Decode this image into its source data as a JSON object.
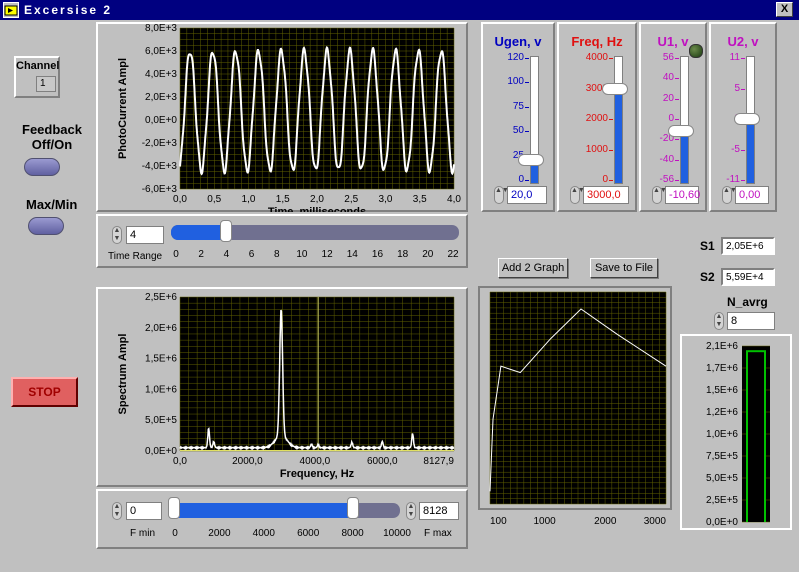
{
  "window": {
    "title": "Excersise 2",
    "close_label": "X"
  },
  "controls": {
    "channel": {
      "label": "Channel",
      "value": "1"
    },
    "feedback_label": "Feedback\nOff/On",
    "maxmin_label": "Max/Min",
    "stop_label": "STOP",
    "time_range": {
      "label": "Time Range",
      "value": "4",
      "level": 4,
      "ticks": [
        "0",
        "2",
        "4",
        "6",
        "8",
        "10",
        "12",
        "14",
        "16",
        "18",
        "20",
        "22"
      ]
    },
    "freq_range": {
      "fmin_label": "F min",
      "fmin_value": "0",
      "fmax_label": "F max",
      "fmax_value": "8128",
      "ticks": [
        "0",
        "2000",
        "4000",
        "6000",
        "8000",
        "10000"
      ]
    },
    "add_graph_label": "Add 2 Graph",
    "save_file_label": "Save to File",
    "s1": {
      "label": "S1",
      "value": "2,05E+6"
    },
    "s2": {
      "label": "S2",
      "value": "5,59E+4"
    },
    "n_avrg": {
      "label": "N_avrg",
      "value": "8"
    }
  },
  "sliders": [
    {
      "title": "Ugen, v",
      "color": "#0000c0",
      "ticks": [
        "120",
        "100",
        "75",
        "50",
        "25",
        "0"
      ],
      "value_text": "20,0",
      "value": 20,
      "min": 0,
      "max": 120
    },
    {
      "title": "Freq, Hz",
      "color": "#e01010",
      "ticks": [
        "4000",
        "3000",
        "2000",
        "1000",
        "0"
      ],
      "value_text": "3000,0",
      "value": 3000,
      "min": 0,
      "max": 4000
    },
    {
      "title": "U1, v",
      "color": "#c010c0",
      "ticks": [
        "56",
        "40",
        "20",
        "0",
        "-20",
        "-40",
        "-56"
      ],
      "value_text": "-10,60",
      "value": -10.6,
      "min": -56,
      "max": 56
    },
    {
      "title": "U2, v",
      "color": "#c010c0",
      "ticks": [
        "11",
        "5",
        "0",
        "-5",
        "-11"
      ],
      "value_text": "0,00",
      "value": 0,
      "min": -11,
      "max": 11
    }
  ],
  "chart_data": [
    {
      "type": "line",
      "title": "",
      "xlabel": "Time, milliseconds",
      "ylabel": "PhotoCurrent Ampl",
      "xlim": [
        0,
        4
      ],
      "ylim": [
        -6000,
        8000
      ],
      "xticks": [
        "0,0",
        "0,5",
        "1,0",
        "1,5",
        "2,0",
        "2,5",
        "3,0",
        "3,5",
        "4,0"
      ],
      "yticks": [
        "8,0E+3",
        "6,0E+3",
        "4,0E+3",
        "2,0E+3",
        "0,0E+0",
        "-2,0E+3",
        "-4,0E+3",
        "-6,0E+3"
      ],
      "series": [
        {
          "frequency_hz": 3000,
          "amplitude": 5200,
          "offset": 800
        }
      ],
      "grid": true
    },
    {
      "type": "line",
      "title": "",
      "xlabel": "Frequency, Hz",
      "ylabel": "Spectrum Ampl",
      "xlim": [
        0,
        8127.9
      ],
      "ylim": [
        0,
        2500000
      ],
      "xticks": [
        "0,0",
        "2000,0",
        "4000,0",
        "6000,0",
        "8127,9"
      ],
      "yticks": [
        "2,5E+6",
        "2,0E+6",
        "1,5E+6",
        "1,0E+6",
        "5,0E+5",
        "0,0E+0"
      ],
      "peaks": [
        [
          850,
          320000
        ],
        [
          1000,
          100000
        ],
        [
          3000,
          2050000
        ],
        [
          3900,
          60000
        ],
        [
          4100,
          50000
        ],
        [
          5100,
          90000
        ],
        [
          6000,
          100000
        ],
        [
          6900,
          230000
        ]
      ],
      "baseline": 40000,
      "grid": true
    },
    {
      "type": "line",
      "title": "",
      "xlim": [
        100,
        3000
      ],
      "xticks": [
        "100",
        "1000",
        "2000",
        "3000"
      ],
      "x": [
        100,
        150,
        280,
        600,
        1100,
        1600,
        2200,
        3000
      ],
      "y": [
        0.06,
        0.4,
        0.65,
        0.62,
        0.78,
        0.92,
        0.8,
        0.65
      ],
      "grid": true
    },
    {
      "type": "bar",
      "title": "",
      "yticks": [
        "2,1E+6",
        "1,7E+6",
        "1,5E+6",
        "1,2E+6",
        "1,0E+6",
        "7,5E+5",
        "5,0E+5",
        "2,5E+5",
        "0,0E+0"
      ],
      "ylim": [
        0,
        2100000
      ],
      "values": [
        2050000
      ],
      "grid": true
    }
  ]
}
